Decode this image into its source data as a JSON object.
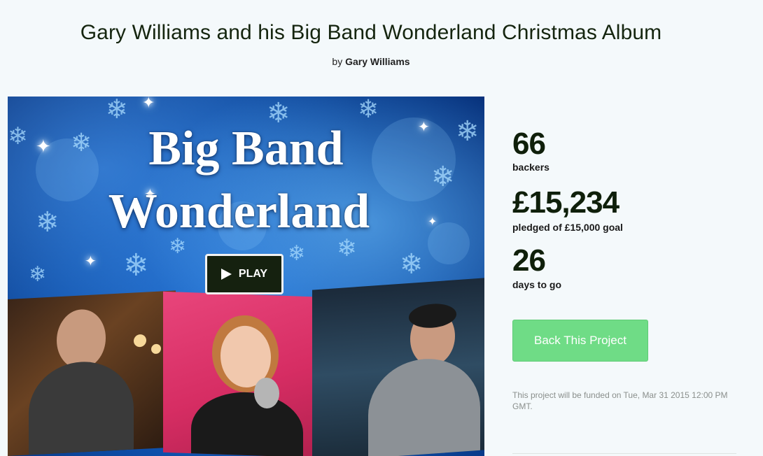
{
  "project": {
    "title": "Gary Williams and his Big Band Wonderland Christmas Album",
    "by_prefix": "by",
    "creator": "Gary Williams"
  },
  "video": {
    "title_line1": "Big Band",
    "title_line2": "Wonderland",
    "play_label": "PLAY"
  },
  "stats": {
    "backers_value": "66",
    "backers_label": "backers",
    "pledged_value": "£15,234",
    "pledged_label": "pledged of £15,000 goal",
    "days_value": "26",
    "days_label": "days to go"
  },
  "cta": {
    "back_label": "Back This Project",
    "color": "#6fdc86"
  },
  "funding_note": "This project will be funded on Tue, Mar 31 2015 12:00 PM GMT."
}
